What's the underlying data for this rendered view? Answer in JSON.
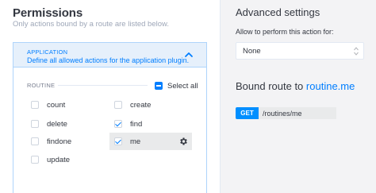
{
  "permissions": {
    "title": "Permissions",
    "subtitle": "Only actions bound by a route are listed below."
  },
  "plugin": {
    "name": "APPLICATION",
    "description": "Define all allowed actions for the application plugin.",
    "section_label": "ROUTINE",
    "select_all_label": "Select all",
    "actions": [
      {
        "label": "count",
        "checked": false
      },
      {
        "label": "create",
        "checked": false
      },
      {
        "label": "delete",
        "checked": false
      },
      {
        "label": "find",
        "checked": true
      },
      {
        "label": "findone",
        "checked": false
      },
      {
        "label": "me",
        "checked": true
      },
      {
        "label": "update",
        "checked": false
      }
    ]
  },
  "advanced": {
    "title": "Advanced settings",
    "allow_label": "Allow to perform this action for:",
    "select_value": "None"
  },
  "bound_route": {
    "title_prefix": "Bound route to",
    "route_name": "routine.me",
    "method": "GET",
    "path": "/routines/me"
  },
  "colors": {
    "accent": "#007eff",
    "header_bg": "#e6f0fb",
    "method_bg": "#008fff",
    "panel_bg": "#f3f3f5"
  }
}
